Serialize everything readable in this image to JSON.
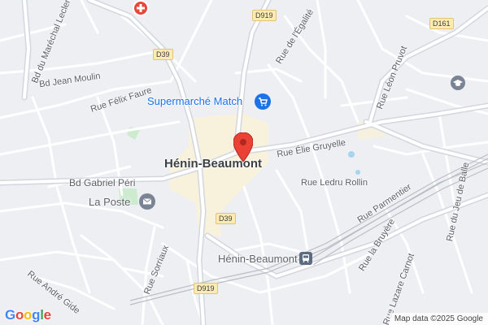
{
  "map": {
    "town": "Hénin-Beaumont",
    "pin_color": "#ea4335",
    "streets": {
      "bd_marechal_leclerc": "Bd du Maréchal Leclerc",
      "bd_jean_moulin": "Bd Jean Moulin",
      "rue_felix_faure": "Rue Félix Faure",
      "rue_egalite": "Rue de l'Égalité",
      "rue_leon_pruvot": "Rue Léon Pruvot",
      "rue_elie_gruyelle": "Rue Élie Gruyelle",
      "bd_gabriel_peri": "Bd Gabriel Péri",
      "rue_ledru_rollin": "Rue Ledru Rollin",
      "rue_parmentier": "Rue Parmentier",
      "rue_jeu_de_balle": "Rue du Jeu de Balle",
      "rue_la_bruyere": "Rue la Bruyère",
      "rue_lazare_carnot": "Rue Lazare Carnot",
      "rue_sorriaux": "Rue Sorriaux",
      "rue_andre_gide": "Rue André Gide"
    },
    "roads": {
      "d919_top": "D919",
      "d39_top": "D39",
      "d161": "D161",
      "d39_mid": "D39",
      "d919_bottom": "D919"
    },
    "pois": {
      "supermarket": "Supermarché Match",
      "post_office": "La Poste",
      "station": "Hénin-Beaumont"
    },
    "attribution": "Map data ©2025 Google",
    "logo": "Google"
  }
}
